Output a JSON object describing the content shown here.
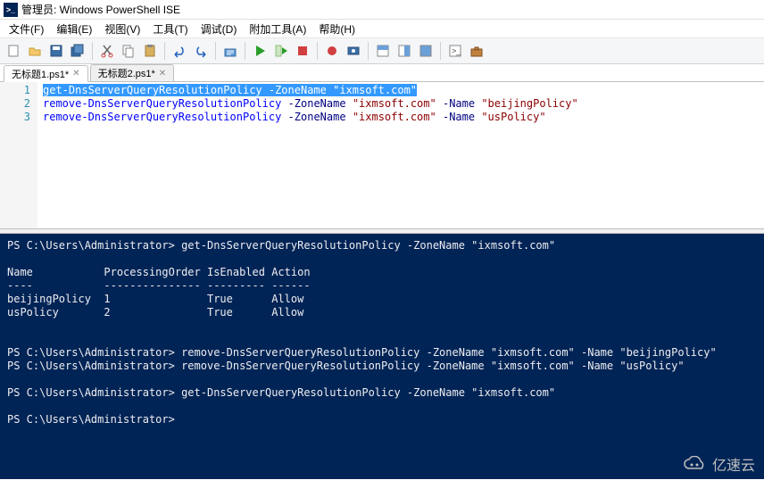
{
  "window": {
    "title": "管理员: Windows PowerShell ISE"
  },
  "menu": {
    "file": "文件(F)",
    "edit": "编辑(E)",
    "view": "视图(V)",
    "tools": "工具(T)",
    "debug": "调试(D)",
    "addons": "附加工具(A)",
    "help": "帮助(H)"
  },
  "tabs": [
    {
      "label": "无标题1.ps1*",
      "active": true
    },
    {
      "label": "无标题2.ps1*",
      "active": false
    }
  ],
  "editor": {
    "lines": [
      {
        "n": "1",
        "selected": true,
        "segments": [
          {
            "t": "get-DnsServerQueryResolutionPolicy",
            "c": "cmd"
          },
          {
            "t": " "
          },
          {
            "t": "-ZoneName",
            "c": "param"
          },
          {
            "t": " "
          },
          {
            "t": "\"ixmsoft.com\"",
            "c": "str"
          }
        ]
      },
      {
        "n": "2",
        "segments": [
          {
            "t": "remove-DnsServerQueryResolutionPolicy",
            "c": "cmd"
          },
          {
            "t": " "
          },
          {
            "t": "-ZoneName",
            "c": "param"
          },
          {
            "t": " "
          },
          {
            "t": "\"ixmsoft.com\"",
            "c": "str"
          },
          {
            "t": " "
          },
          {
            "t": "-Name",
            "c": "param"
          },
          {
            "t": " "
          },
          {
            "t": "\"beijingPolicy\"",
            "c": "str"
          }
        ]
      },
      {
        "n": "3",
        "segments": [
          {
            "t": "remove-DnsServerQueryResolutionPolicy",
            "c": "cmd"
          },
          {
            "t": " "
          },
          {
            "t": "-ZoneName",
            "c": "param"
          },
          {
            "t": " "
          },
          {
            "t": "\"ixmsoft.com\"",
            "c": "str"
          },
          {
            "t": " "
          },
          {
            "t": "-Name",
            "c": "param"
          },
          {
            "t": " "
          },
          {
            "t": "\"usPolicy\"",
            "c": "str"
          }
        ]
      }
    ]
  },
  "console": {
    "prompt": "PS C:\\Users\\Administrator>",
    "cmd1": "get-DnsServerQueryResolutionPolicy -ZoneName \"ixmsoft.com\"",
    "header": "Name           ProcessingOrder IsEnabled Action",
    "divider": "----           --------------- --------- ------",
    "row1": "beijingPolicy  1               True      Allow",
    "row2": "usPolicy       2               True      Allow",
    "cmd2": "remove-DnsServerQueryResolutionPolicy -ZoneName \"ixmsoft.com\" -Name \"beijingPolicy\"",
    "cmd3": "remove-DnsServerQueryResolutionPolicy -ZoneName \"ixmsoft.com\" -Name \"usPolicy\"",
    "cmd4": "get-DnsServerQueryResolutionPolicy -ZoneName \"ixmsoft.com\""
  },
  "watermark": {
    "text": "亿速云"
  },
  "icons": {
    "new": "new",
    "open": "open",
    "save": "save",
    "saveall": "saveall",
    "cut": "cut",
    "copy": "copy",
    "paste": "paste",
    "undo": "undo",
    "redo": "redo",
    "run": "run",
    "runsel": "runsel",
    "stop": "stop",
    "br": "br",
    "rm": "rm",
    "panel1": "p1",
    "panel2": "p2",
    "panel3": "p3",
    "cmdpane": "cmd",
    "toolbox": "tb"
  }
}
